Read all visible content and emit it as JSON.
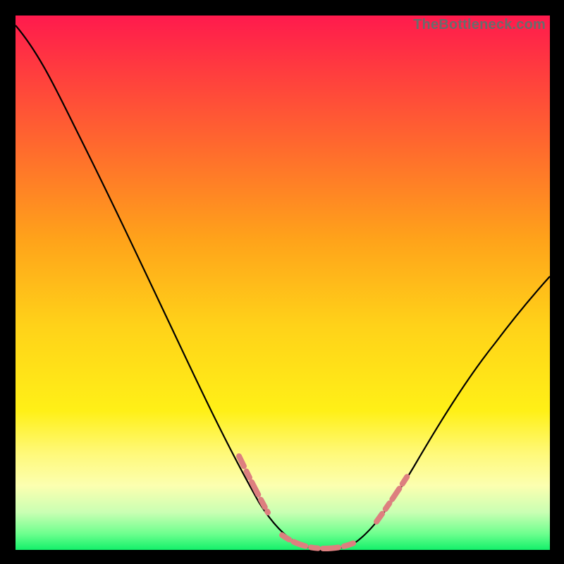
{
  "watermark": "TheBottleneck.com",
  "chart_data": {
    "type": "line",
    "title": "",
    "xlabel": "",
    "ylabel": "",
    "xlim": [
      0,
      100
    ],
    "ylim": [
      0,
      100
    ],
    "x": [
      0,
      3,
      6,
      9,
      12,
      15,
      18,
      21,
      24,
      27,
      30,
      33,
      36,
      39,
      42,
      45,
      48,
      51,
      53,
      55,
      57,
      59,
      61,
      64,
      67,
      70,
      73,
      76,
      79,
      82,
      85,
      88,
      91,
      94,
      97,
      100
    ],
    "values": [
      98,
      94,
      89,
      84,
      79,
      73,
      67,
      61,
      55,
      49,
      43,
      37,
      31,
      25,
      19,
      14,
      9,
      5,
      3,
      1.5,
      0.7,
      0.4,
      0.7,
      2,
      5,
      9,
      14,
      19,
      24,
      29,
      34,
      39,
      44,
      48,
      53,
      57
    ],
    "highlight_band": {
      "color": "#e07a7a",
      "segments": [
        {
          "x_from": 40.5,
          "x_to": 45.5
        },
        {
          "x_from": 49,
          "x_to": 63
        },
        {
          "x_from": 67,
          "x_to": 73
        }
      ]
    },
    "curve_color": "#000000",
    "background_gradient": {
      "top": "#ff1a4d",
      "bottom": "#13f06a"
    }
  }
}
